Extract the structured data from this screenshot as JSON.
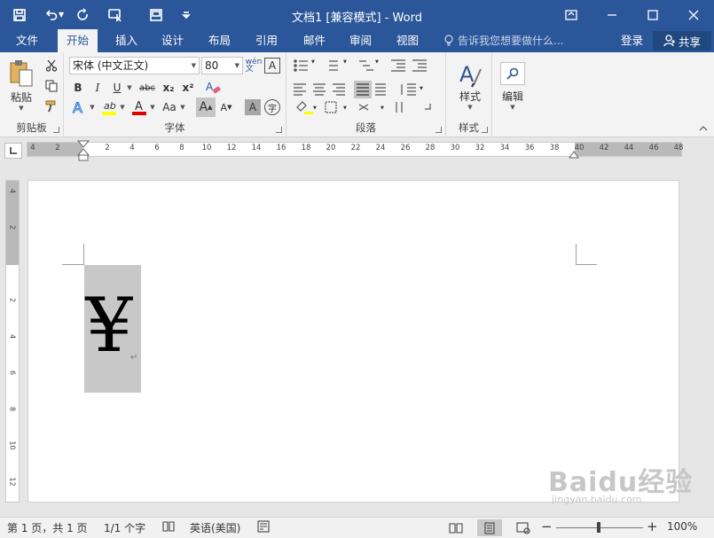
{
  "title_bar": {
    "title": "文档1 [兼容模式] - Word",
    "colors": {
      "brand": "#2b579a",
      "ribbon_bg": "#f3f3f3",
      "share_bg": "#21497f"
    }
  },
  "tabs": [
    "文件",
    "开始",
    "插入",
    "设计",
    "布局",
    "引用",
    "邮件",
    "审阅",
    "视图"
  ],
  "active_tab": "开始",
  "tell_me": {
    "placeholder": "告诉我您想要做什么..."
  },
  "account": {
    "login": "登录",
    "share": "共享"
  },
  "ribbon": {
    "clipboard": {
      "paste": "粘贴",
      "label": "剪贴板"
    },
    "font": {
      "font_name": "宋体 (中文正文)",
      "font_size": "80",
      "bold": "B",
      "italic": "I",
      "underline": "U",
      "strike": "abc",
      "subscript": "x₂",
      "superscript": "x²",
      "change_case": "Aa",
      "grow": "A",
      "shrink": "A",
      "label": "字体"
    },
    "paragraph": {
      "label": "段落"
    },
    "styles": {
      "button": "样式",
      "label": "样式"
    },
    "editing": {
      "button": "编辑"
    }
  },
  "ruler": {
    "horizontal": [
      "4",
      "2",
      "2",
      "4",
      "6",
      "8",
      "10",
      "12",
      "14",
      "16",
      "18",
      "20",
      "22",
      "24",
      "26",
      "28",
      "30",
      "32",
      "34",
      "36",
      "38",
      "40",
      "42",
      "44",
      "46",
      "48"
    ],
    "vertical": [
      "4",
      "2",
      "2",
      "4",
      "6",
      "8",
      "10",
      "12"
    ]
  },
  "document": {
    "content": "¥",
    "paragraph_mark": "↵",
    "selection_color": "#c8c8c8"
  },
  "status_bar": {
    "page": "第 1 页，共 1 页",
    "words": "1/1 个字",
    "language": "英语(美国)",
    "zoom": "100%",
    "zoom_minus": "−",
    "zoom_plus": "+"
  },
  "watermark": {
    "text": "Baidu经验",
    "url": "jingyan.baidu.com"
  }
}
